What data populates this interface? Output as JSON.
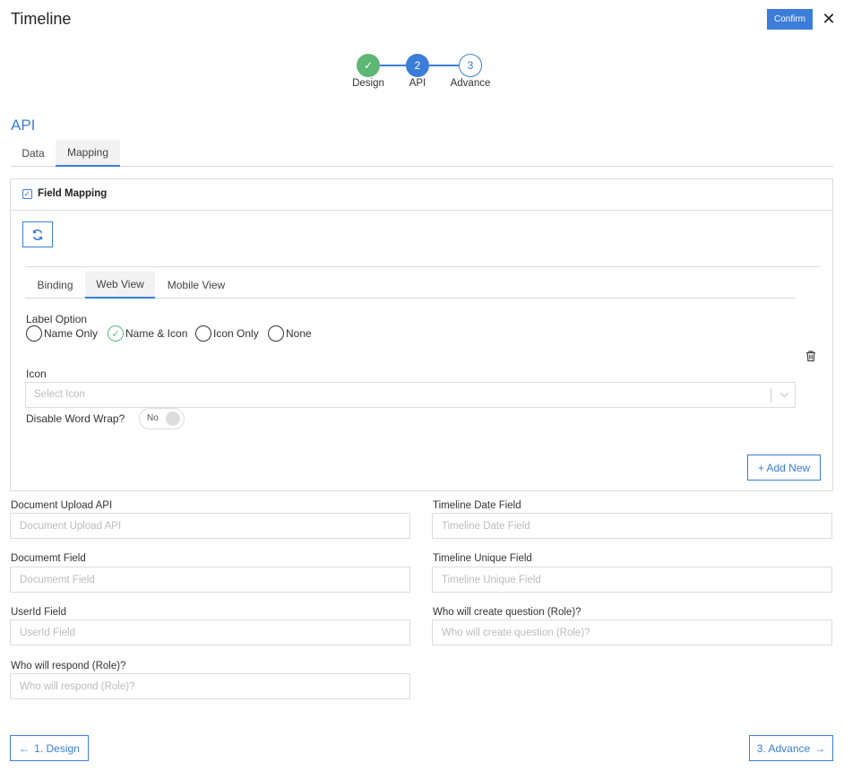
{
  "header": {
    "title": "Timeline",
    "confirm_label": "Confirm",
    "close_glyph": "✕"
  },
  "stepper": {
    "steps": [
      {
        "number": "✓",
        "label": "Design",
        "state": "done"
      },
      {
        "number": "2",
        "label": "API",
        "state": "active"
      },
      {
        "number": "3",
        "label": "Advance",
        "state": "todo"
      }
    ]
  },
  "section": {
    "title": "API"
  },
  "top_tabs": [
    {
      "label": "Data",
      "selected": false
    },
    {
      "label": "Mapping",
      "selected": true
    }
  ],
  "field_mapping": {
    "title": "Field Mapping",
    "checked": true,
    "inner_tabs": [
      {
        "label": "Binding",
        "selected": false
      },
      {
        "label": "Web View",
        "selected": true
      },
      {
        "label": "Mobile View",
        "selected": false
      }
    ],
    "label_option": {
      "title": "Label Option",
      "options": [
        {
          "label": "Name Only",
          "checked": false
        },
        {
          "label": "Name & Icon",
          "checked": true
        },
        {
          "label": "Icon Only",
          "checked": false
        },
        {
          "label": "None",
          "checked": false
        }
      ]
    },
    "icon": {
      "label": "Icon",
      "placeholder": "Select Icon"
    },
    "word_wrap": {
      "label": "Disable Word Wrap?",
      "value": "No"
    },
    "add_new_label": "+ Add New"
  },
  "fields": {
    "document_upload_api": {
      "label": "Document Upload API",
      "placeholder": "Document Upload API"
    },
    "timeline_date_field": {
      "label": "Timeline Date Field",
      "placeholder": "Timeline Date Field"
    },
    "document_field": {
      "label": "Documemt Field",
      "placeholder": "Documemt Field"
    },
    "timeline_unique_field": {
      "label": "Timeline Unique Field",
      "placeholder": "Timeline Unique Field"
    },
    "userid_field": {
      "label": "UserId Field",
      "placeholder": "UserId Field"
    },
    "who_create_question": {
      "label": "Who will create question (Role)?",
      "placeholder": "Who will create question (Role)?"
    },
    "who_respond": {
      "label": "Who will respond (Role)?",
      "placeholder": "Who will respond (Role)?"
    }
  },
  "footer": {
    "back_label": "1. Design",
    "next_label": "3. Advance"
  },
  "colors": {
    "accent": "#3b7dd8",
    "success": "#5cb874",
    "border": "#dcdcdc"
  }
}
